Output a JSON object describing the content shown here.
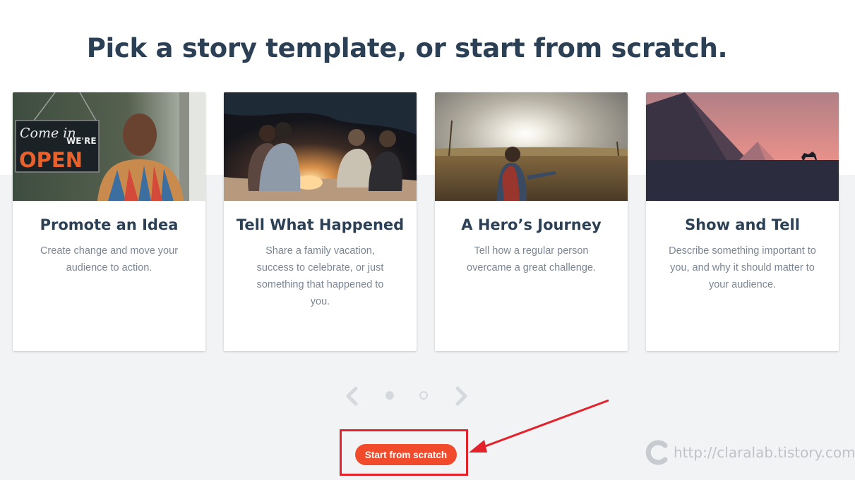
{
  "page": {
    "title": "Pick a story template, or start from scratch."
  },
  "cards": [
    {
      "title": "Promote an Idea",
      "description": "Create change and move your audience to action.",
      "sign_line1": "Come in",
      "sign_line2": "WE'RE",
      "sign_line3": "OPEN"
    },
    {
      "title": "Tell What Happened",
      "description": "Share a family vacation, success to celebrate, or just something that happened to you."
    },
    {
      "title": "A Hero’s Journey",
      "description": "Tell how a regular person overcame a great challenge."
    },
    {
      "title": "Show and Tell",
      "description": "Describe something important to you, and why it should matter to your audience."
    }
  ],
  "pager": {
    "pages": 2,
    "current": 1
  },
  "actions": {
    "start_label": "Start from scratch"
  },
  "watermark": {
    "text": "http://claralab.tistory.com"
  },
  "colors": {
    "accent": "#f24b2c",
    "heading": "#2b3f55",
    "annotation": "#e3222b"
  }
}
